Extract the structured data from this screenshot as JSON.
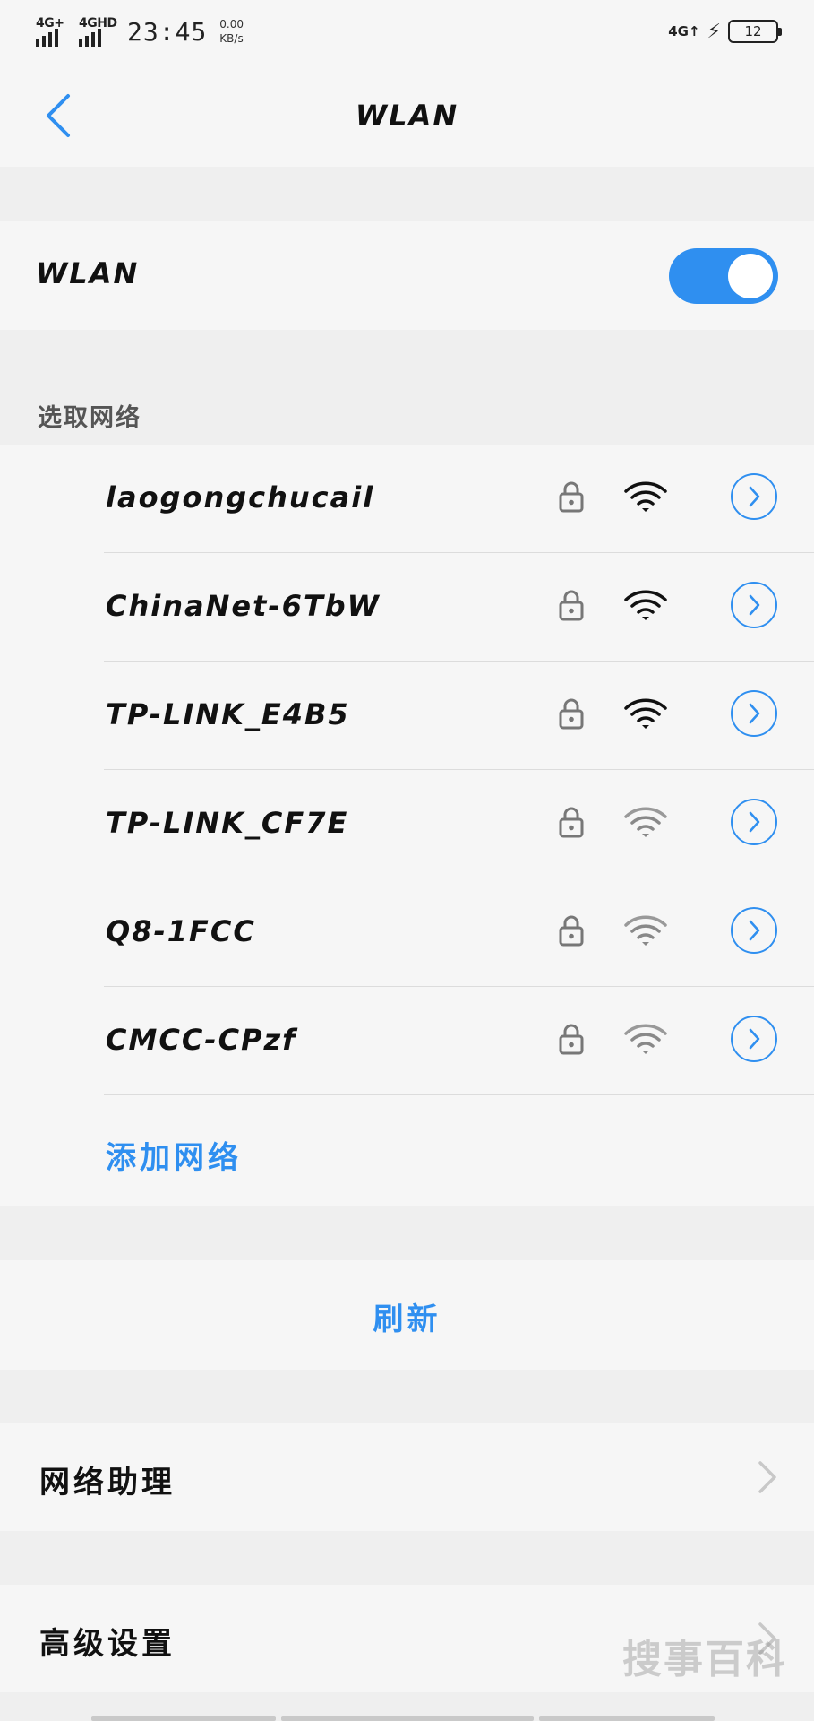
{
  "status_bar": {
    "net1": "4G+",
    "net2": "4GHD",
    "time": "23:45",
    "speed_value": "0.00",
    "speed_unit": "KB/s",
    "right_net": "4G↑",
    "battery": "12"
  },
  "header": {
    "title": "WLAN",
    "back_icon": "chevron-left-icon"
  },
  "wlan_toggle": {
    "label": "WLAN",
    "enabled": true,
    "accent": "#2f8ff0"
  },
  "networks": {
    "section_label": "选取网络",
    "items": [
      {
        "ssid": "laogongchucail",
        "secured": true,
        "signal": "strong"
      },
      {
        "ssid": "ChinaNet-6TbW",
        "secured": true,
        "signal": "strong"
      },
      {
        "ssid": "TP-LINK_E4B5",
        "secured": true,
        "signal": "strong"
      },
      {
        "ssid": "TP-LINK_CF7E",
        "secured": true,
        "signal": "weak"
      },
      {
        "ssid": "Q8-1FCC",
        "secured": true,
        "signal": "weak"
      },
      {
        "ssid": "CMCC-CPzf",
        "secured": true,
        "signal": "weak"
      }
    ],
    "add_label": "添加网络"
  },
  "refresh_label": "刷新",
  "menu": {
    "assistant": "网络助理",
    "advanced": "高级设置"
  },
  "watermark": "搜事百科"
}
